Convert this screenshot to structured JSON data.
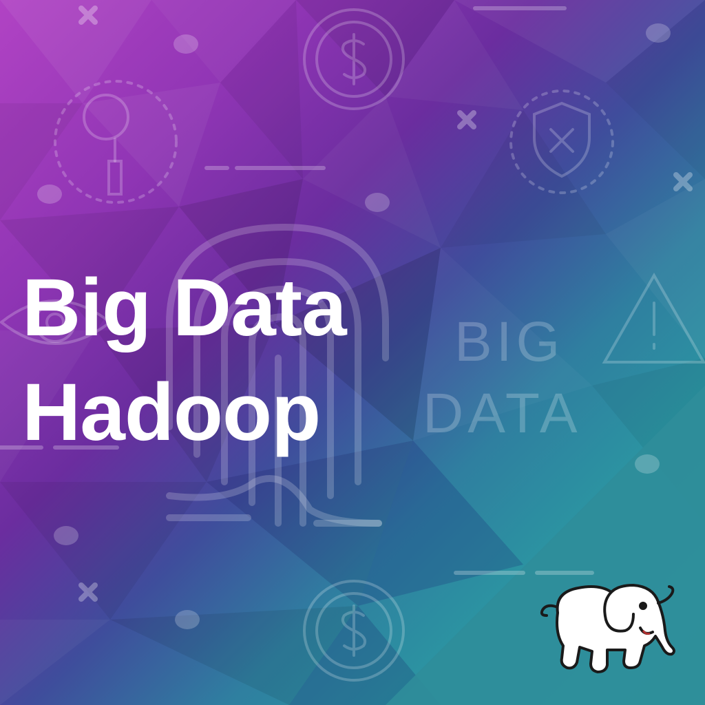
{
  "title": {
    "line1": "Big Data",
    "line2": "Hadoop"
  },
  "background_text": {
    "word1": "BIG",
    "word2": "DATA"
  },
  "icons": [
    "dollar-coin-icon",
    "magnifier-icon",
    "shield-x-icon",
    "fingerprint-icon",
    "eye-icon",
    "warning-icon",
    "hadoop-elephant-logo"
  ],
  "colors": {
    "purple": "#b143c4",
    "deep_purple": "#6b2d9f",
    "indigo": "#3f4d9c",
    "teal": "#2a9aa2",
    "corner_teal": "#2f8d9a",
    "title_text": "#ffffff"
  }
}
